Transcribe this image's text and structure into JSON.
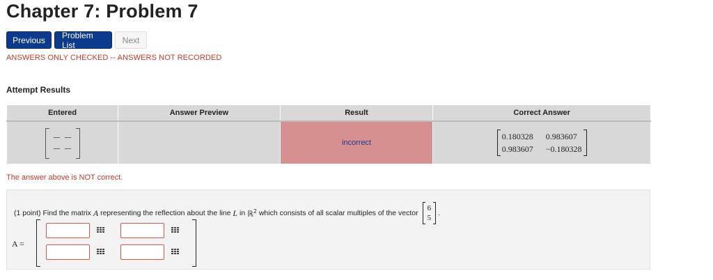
{
  "header": {
    "title": "Chapter 7: Problem 7"
  },
  "nav": {
    "previous": "Previous",
    "problem_list": "Problem List",
    "next": "Next"
  },
  "status": "ANSWERS ONLY CHECKED -- ANSWERS NOT RECORDED",
  "attempt": {
    "heading": "Attempt Results",
    "columns": [
      "Entered",
      "Answer Preview",
      "Result",
      "Correct Answer"
    ],
    "row": {
      "entered": "[[ — , — ], [ — , — ]]",
      "preview": "",
      "result": "incorrect",
      "correct_answer": [
        [
          "0.180328",
          "0.983607"
        ],
        [
          "0.983607",
          "−0.180328"
        ]
      ]
    }
  },
  "feedback": "The answer above is NOT correct.",
  "problem": {
    "points": "(1 point)",
    "text_before": "Find the matrix",
    "matrix_var": "A",
    "text_mid1": "representing the reflection about the line",
    "line_var": "L",
    "text_in": "in",
    "space": "ℝ",
    "space_exp": "2",
    "text_after": "which consists of all scalar multiples of the vector",
    "vector": [
      "6",
      "5"
    ],
    "answer_label": "A ="
  },
  "colors": {
    "primary_button": "#0c3a8c",
    "error_text": "#c0392b",
    "incorrect_bg": "#d69090"
  }
}
